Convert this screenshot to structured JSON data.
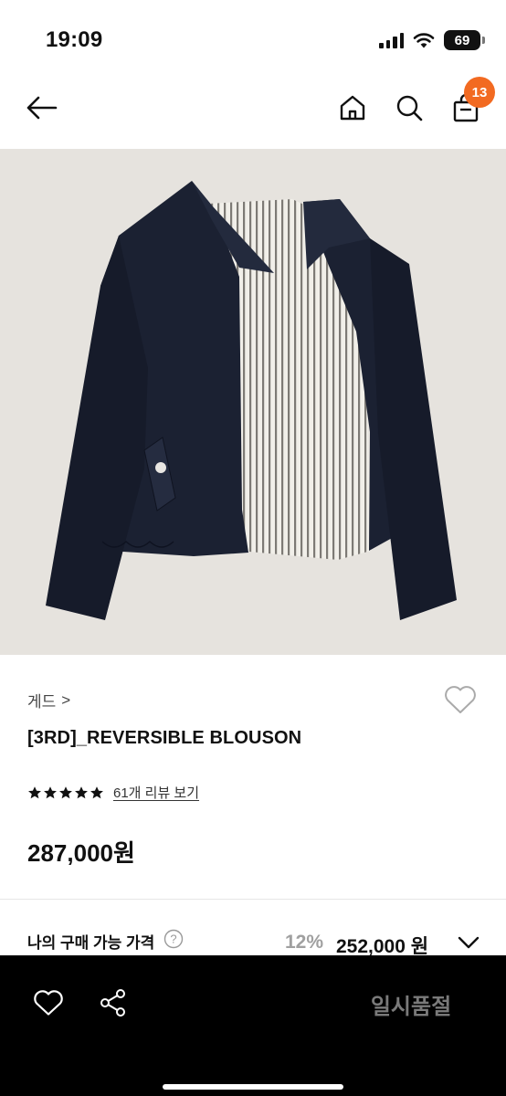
{
  "status_bar": {
    "time": "19:09",
    "battery": "69"
  },
  "nav": {
    "back_icon": "arrow-left-icon",
    "home_icon": "home-icon",
    "search_icon": "search-icon",
    "cart_icon": "shopping-bag-icon",
    "cart_count": "13"
  },
  "product": {
    "image": "navy reversible blouson jacket with striped lining",
    "brand": "게드",
    "brand_chevron": ">",
    "name": "[3RD]_REVERSIBLE BLOUSON",
    "rating_stars": 5,
    "review_link": "61개 리뷰 보기",
    "price": "287,000원"
  },
  "my_price": {
    "label": "나의 구매 가능 가격",
    "discount": "12%",
    "price": "252,000 원"
  },
  "bottom_bar": {
    "heart_icon": "heart-icon",
    "share_icon": "share-icon",
    "status_button": "일시품절"
  },
  "colors": {
    "badge": "#f26a21",
    "bottom_bar_bg": "#000000",
    "sold_out_text": "#7a7a7a",
    "image_bg": "#e6e3de"
  }
}
